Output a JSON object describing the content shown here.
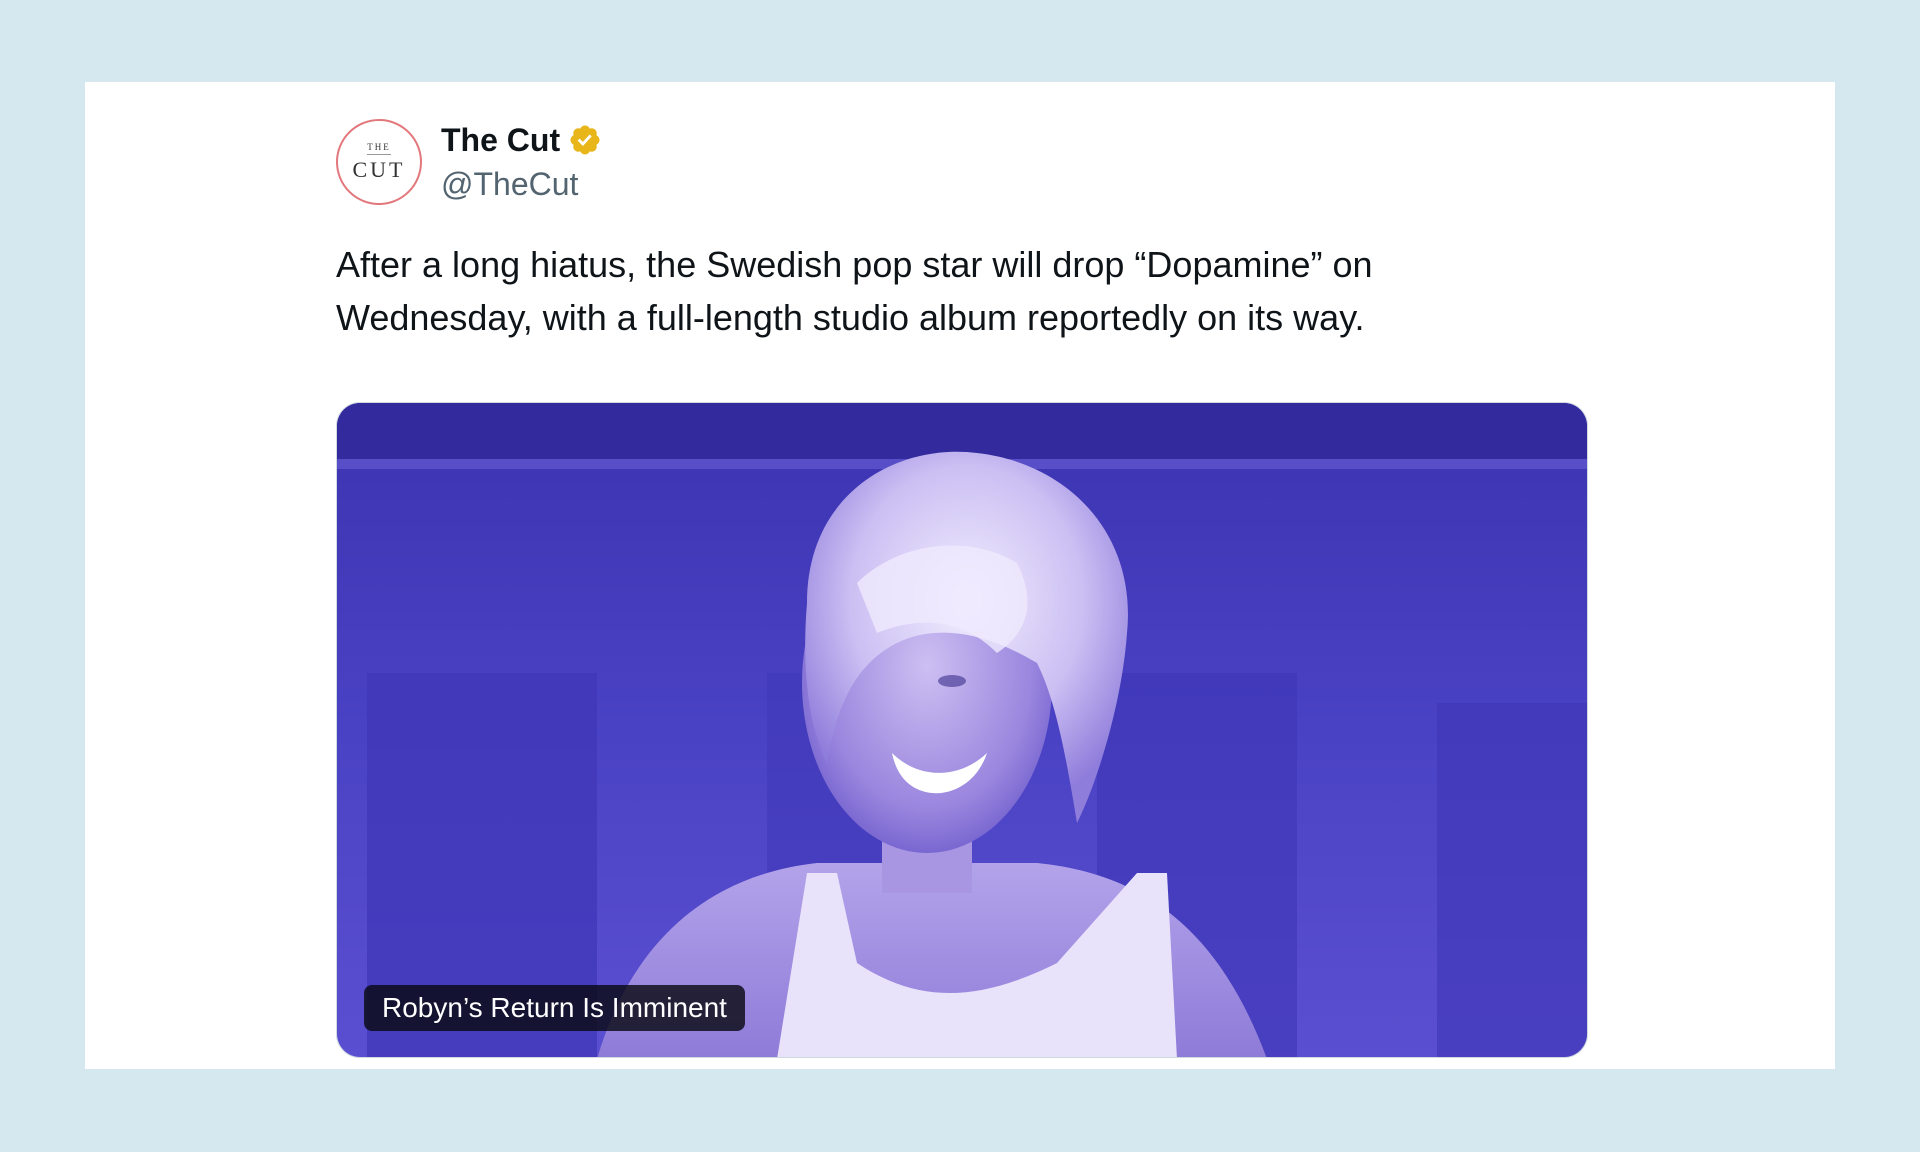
{
  "account": {
    "avatar_small": "THE",
    "avatar_big": "CUT",
    "display_name": "The Cut",
    "handle": "@TheCut",
    "verified_icon": "verified-badge-icon",
    "verified_color": "#e8b619"
  },
  "tweet": {
    "text": "After a long hiatus, the Swedish pop star will drop “Dopamine” on\nWednesday, with a full-length studio album reportedly on its way."
  },
  "media": {
    "caption": "Robyn’s Return Is Imminent",
    "tint_color": "#4b3fc4"
  },
  "colors": {
    "background": "#d6e8ef",
    "card": "#ffffff",
    "text": "#0f1419",
    "secondary_text": "#536471"
  }
}
